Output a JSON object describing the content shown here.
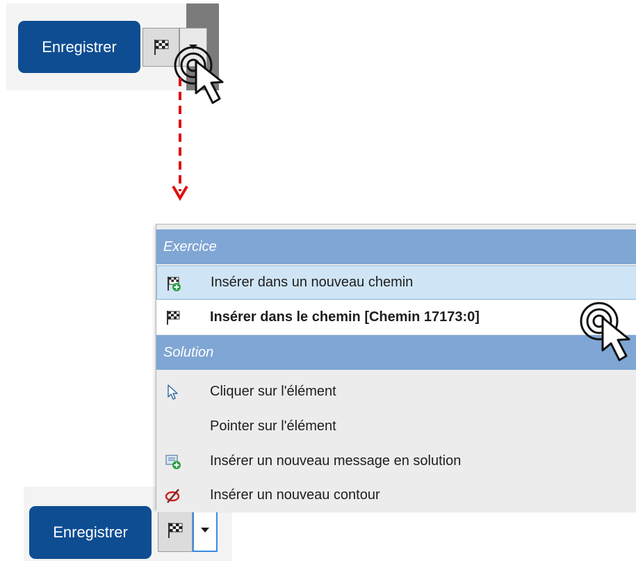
{
  "top_toolbar": {
    "save_label": "Enregistrer"
  },
  "bottom_toolbar": {
    "save_label": "Enregistrer"
  },
  "menu": {
    "sections": [
      {
        "title": "Exercice",
        "items": [
          {
            "label": "Insérer dans un nouveau chemin",
            "icon": "flag-add-icon"
          },
          {
            "label": "Insérer dans le chemin [Chemin 17173:0]",
            "icon": "flag-icon"
          }
        ]
      },
      {
        "title": "Solution",
        "items": [
          {
            "label": "Cliquer sur l'élément",
            "icon": "pointer-icon"
          },
          {
            "label": "Pointer sur l'élément",
            "icon": ""
          },
          {
            "label": "Insérer un nouveau message en solution",
            "icon": "message-add-icon"
          },
          {
            "label": "Insérer un nouveau contour",
            "icon": "contour-icon"
          }
        ]
      }
    ]
  },
  "colors": {
    "accent": "#0e4d92",
    "section_header": "#7fa6d4",
    "hover": "#cfe5f5",
    "arrow": "#e01010"
  }
}
